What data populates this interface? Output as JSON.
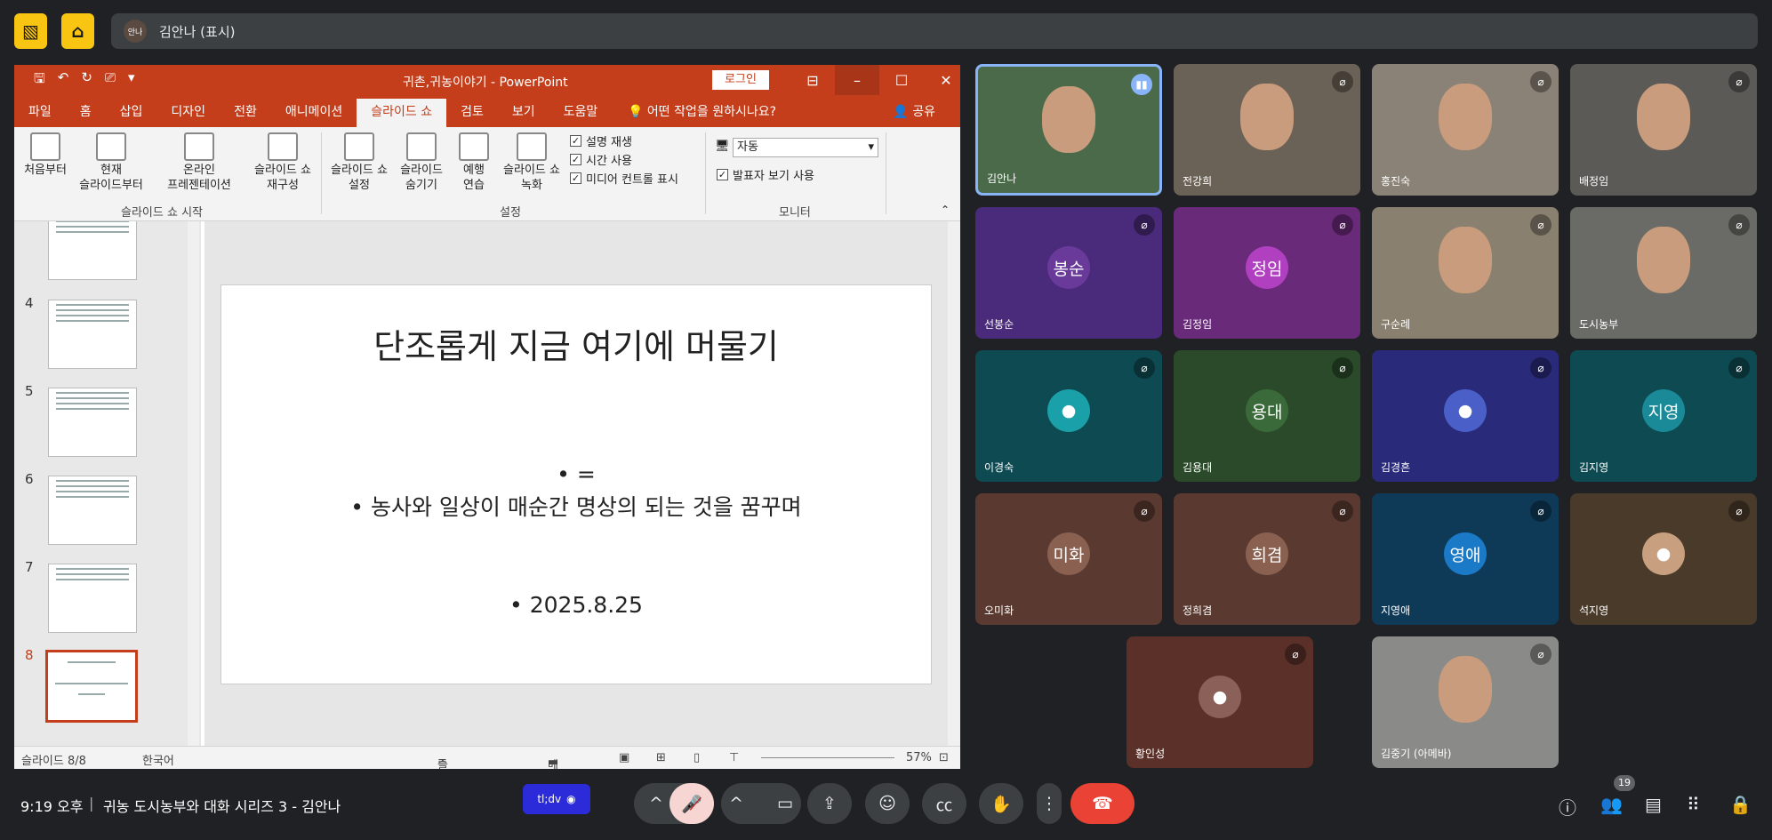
{
  "presenter_bar": {
    "avatar_text": "안나",
    "label": "김안나 (표시)"
  },
  "ppt": {
    "window_title": "귀촌,귀농이야기  -  PowerPoint",
    "login": "로그인",
    "tabs": [
      "파일",
      "홈",
      "삽입",
      "디자인",
      "전환",
      "애니메이션",
      "슬라이드 쇼",
      "검토",
      "보기",
      "도움말"
    ],
    "tell_me": "어떤 작업을 원하시나요?",
    "share": "공유",
    "ribbon": {
      "from_beginning": "처음부터",
      "current_slide": [
        "현재",
        "슬라이드부터"
      ],
      "online": [
        "온라인",
        "프레젠테이션"
      ],
      "custom": [
        "슬라이드 쇼",
        "재구성"
      ],
      "start_group": "슬라이드 쇼 시작",
      "setup": [
        "슬라이드 쇼",
        "설정"
      ],
      "hide": [
        "슬라이드",
        "숨기기"
      ],
      "rehearse": [
        "예행",
        "연습"
      ],
      "record": [
        "슬라이드 쇼",
        "녹화"
      ],
      "play_narration": "설명 재생",
      "use_timings": "시간 사용",
      "show_media": "미디어 컨트롤 표시",
      "setup_group": "설정",
      "monitor_value": "자동",
      "presenter_view": "발표자 보기 사용",
      "monitor_group": "모니터"
    },
    "thumb_numbers": [
      "4",
      "5",
      "6",
      "7",
      "8"
    ],
    "slide": {
      "title": "단조롭게 지금 여기에 머물기",
      "bullet1": "• =",
      "bullet2": "• 농사와 일상이 매순간 명상의 되는 것을 꿈꾸며",
      "bullet3": "• 2025.8.25"
    },
    "status": {
      "slide_count": "슬라이드 8/8",
      "language": "한국어",
      "notes": "슬라이드 노트",
      "comments": "메모",
      "zoom": "57%"
    }
  },
  "participants": [
    {
      "name": "김안나",
      "kind": "photo",
      "bg": "#4a6a4a"
    },
    {
      "name": "전강희",
      "kind": "photo",
      "bg": "#6b6257"
    },
    {
      "name": "홍진숙",
      "kind": "photo",
      "bg": "#8a8276"
    },
    {
      "name": "배정임",
      "kind": "photo",
      "bg": "#5c5a57"
    },
    {
      "name": "선봉순",
      "kind": "avatar",
      "initial": "봉순",
      "bg": "#4a2a7a",
      "avbg": "#6a3a9a"
    },
    {
      "name": "김정임",
      "kind": "avatar",
      "initial": "정임",
      "bg": "#6a2a7a",
      "avbg": "#b040c0"
    },
    {
      "name": "구순례",
      "kind": "photo",
      "bg": "#8a8070"
    },
    {
      "name": "도시농부",
      "kind": "photo",
      "bg": "#6a6a66"
    },
    {
      "name": "이경숙",
      "kind": "avatar",
      "initial": "",
      "bg": "#0e4a52",
      "avbg": "#1aa0a8"
    },
    {
      "name": "김용대",
      "kind": "avatar",
      "initial": "용대",
      "bg": "#2a4a2a",
      "avbg": "#3a6a3a"
    },
    {
      "name": "김경흔",
      "kind": "avatar",
      "initial": "",
      "bg": "#2a2a7a",
      "avbg": "#4a60c8"
    },
    {
      "name": "김지영",
      "kind": "avatar",
      "initial": "지영",
      "bg": "#0e4a52",
      "avbg": "#1a8a98"
    },
    {
      "name": "오미화",
      "kind": "avatar",
      "initial": "미화",
      "bg": "#5a3a30",
      "avbg": "#8a6050"
    },
    {
      "name": "정희겸",
      "kind": "avatar",
      "initial": "희겸",
      "bg": "#5a3a30",
      "avbg": "#8a6050"
    },
    {
      "name": "지영애",
      "kind": "avatar",
      "initial": "영애",
      "bg": "#0e3a58",
      "avbg": "#1a7ac8"
    },
    {
      "name": "석지영",
      "kind": "avatar",
      "initial": "",
      "bg": "#4a3a2a",
      "avbg": "#c8a080"
    },
    {
      "name": "황인성",
      "kind": "avatar",
      "initial": "",
      "bg": "#5a3028",
      "avbg": "#8a6058"
    },
    {
      "name": "김중기 (아메바)",
      "kind": "photo",
      "bg": "#8a8a88"
    }
  ],
  "bottom": {
    "time": "9:19 오후",
    "meeting_title": "귀농 도시농부와 대화 시리즈 3 - 김안나",
    "badge": "tl;dv",
    "participant_count": "19"
  }
}
